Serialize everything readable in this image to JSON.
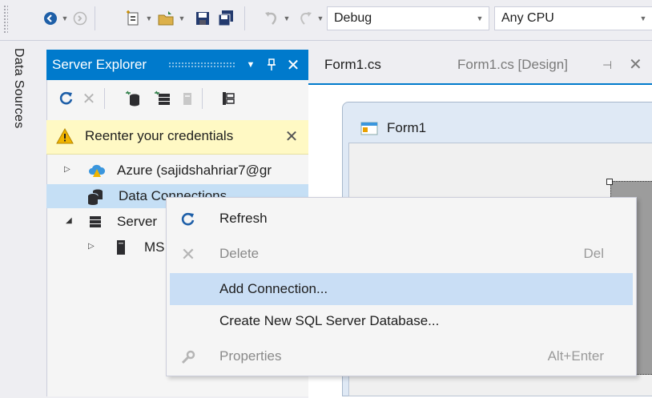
{
  "toolbar": {
    "config_value": "Debug",
    "platform_value": "Any CPU"
  },
  "side_tab": {
    "label": "Data Sources"
  },
  "server_explorer": {
    "title": "Server Explorer",
    "warning_text": "Reenter your credentials",
    "tree": [
      {
        "label": "Azure (sajidshahriar7@gr"
      },
      {
        "label": "Data Connections"
      },
      {
        "label": "Server"
      },
      {
        "label": "MS"
      }
    ]
  },
  "tabs": [
    {
      "label": "Form1.cs"
    },
    {
      "label": "Form1.cs [Design]"
    }
  ],
  "form": {
    "title": "Form1"
  },
  "context_menu": {
    "items": [
      {
        "label": "Refresh",
        "shortcut": "",
        "enabled": true
      },
      {
        "label": "Delete",
        "shortcut": "Del",
        "enabled": false
      },
      {
        "label": "Add Connection...",
        "shortcut": "",
        "enabled": true,
        "highlighted": true
      },
      {
        "label": "Create New SQL Server Database...",
        "shortcut": "",
        "enabled": true
      },
      {
        "label": "Properties",
        "shortcut": "Alt+Enter",
        "enabled": false
      }
    ]
  },
  "colors": {
    "accent": "#007acc",
    "selection": "#c5dff5",
    "warning_bg": "#fff9c4"
  }
}
